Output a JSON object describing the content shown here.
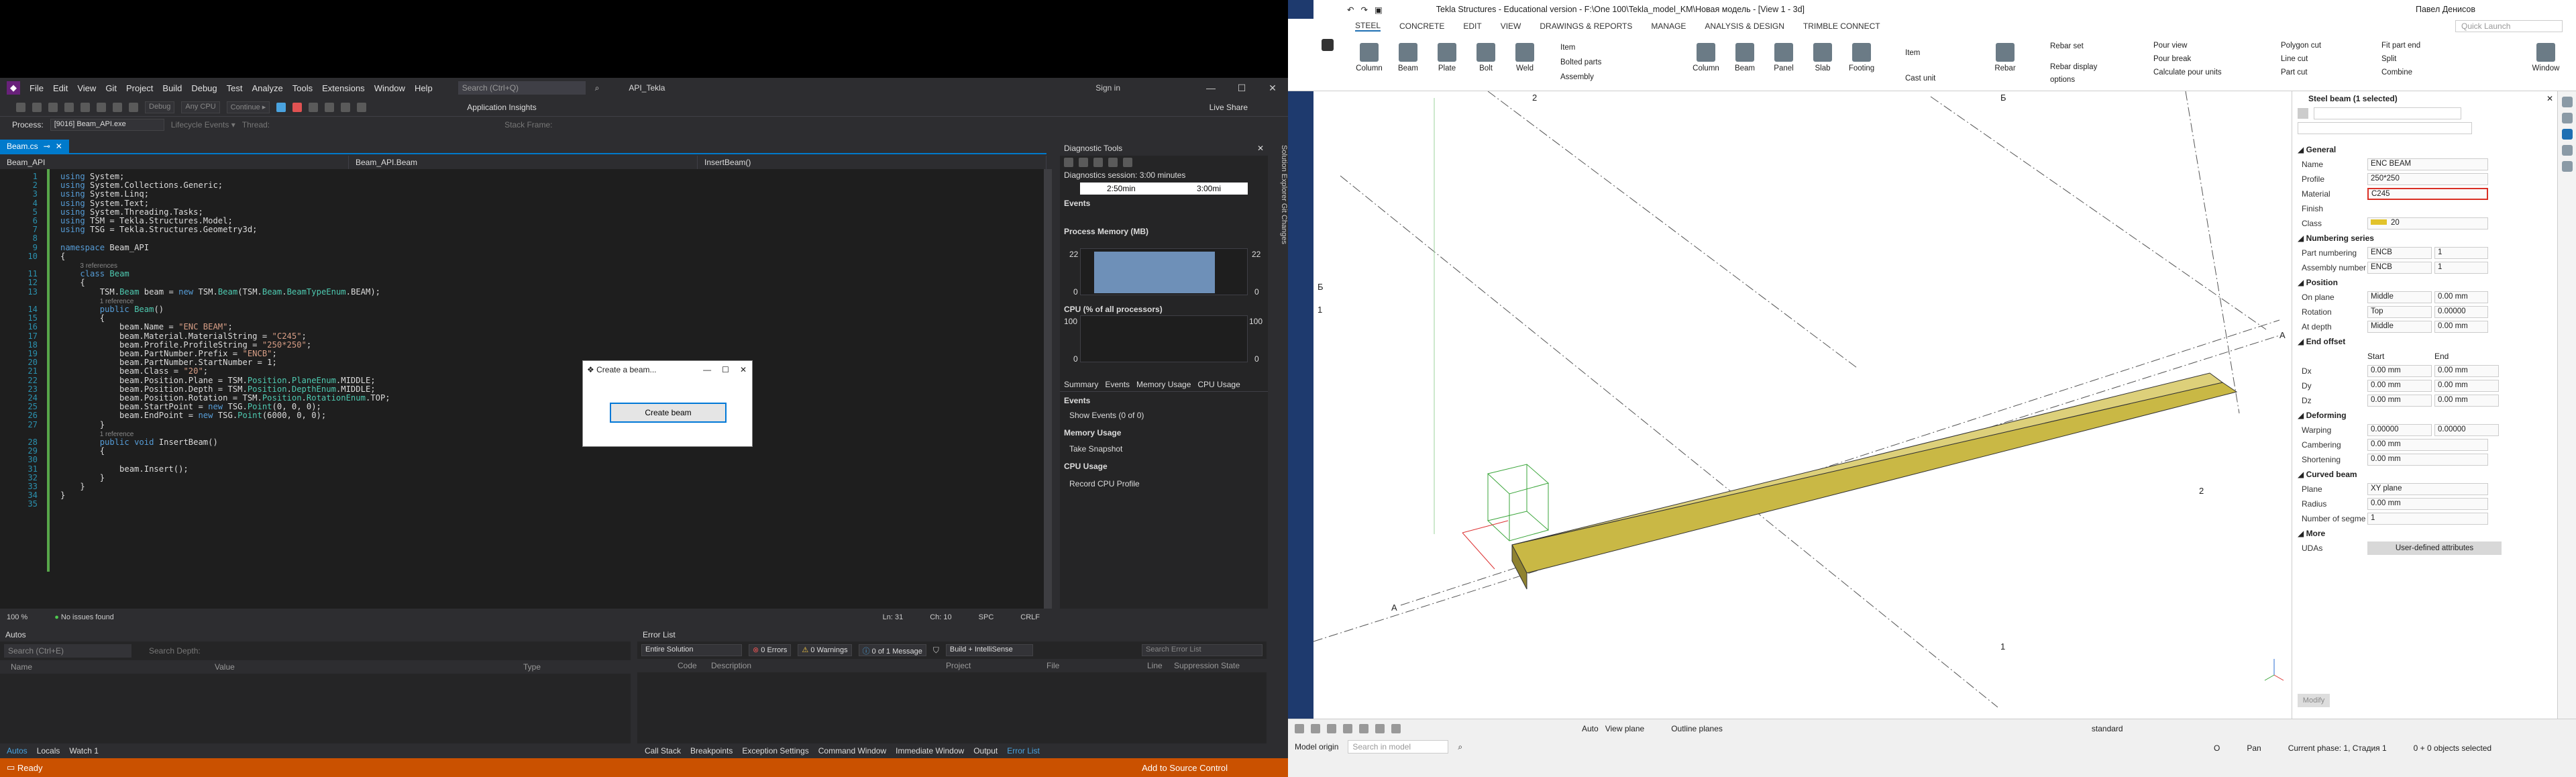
{
  "vs": {
    "menu": [
      "File",
      "Edit",
      "View",
      "Git",
      "Project",
      "Build",
      "Debug",
      "Test",
      "Analyze",
      "Tools",
      "Extensions",
      "Window",
      "Help"
    ],
    "search_placeholder": "Search (Ctrl+Q)",
    "solution_name": "API_Tekla",
    "sign_in": "Sign in",
    "toolbar": {
      "config": "Debug",
      "platform": "Any CPU",
      "continue": "Continue ▸",
      "app_insights": "Application Insights",
      "live_share": "Live Share"
    },
    "process": {
      "label": "Process:",
      "value": "[9016] Beam_API.exe",
      "lifecycle": "Lifecycle Events ▾",
      "thread": "Thread:",
      "stack_frame": "Stack Frame:"
    },
    "doc_tab": "Beam.cs",
    "navbar": {
      "project": "Beam_API",
      "class": "Beam_API.Beam",
      "member": "InsertBeam()"
    },
    "code_lines": [
      {
        "n": "1",
        "html": "<span class='kw'>using</span> System;"
      },
      {
        "n": "2",
        "html": "<span class='kw'>using</span> System.Collections.Generic;"
      },
      {
        "n": "3",
        "html": "<span class='kw'>using</span> System.Linq;"
      },
      {
        "n": "4",
        "html": "<span class='kw'>using</span> System.Text;"
      },
      {
        "n": "5",
        "html": "<span class='kw'>using</span> System.Threading.Tasks;"
      },
      {
        "n": "6",
        "html": "<span class='kw'>using</span> TSM = Tekla.Structures.Model;"
      },
      {
        "n": "7",
        "html": "<span class='kw'>using</span> TSG = Tekla.Structures.Geometry3d;"
      },
      {
        "n": "8",
        "html": ""
      },
      {
        "n": "9",
        "html": "<span class='kw'>namespace</span> Beam_API"
      },
      {
        "n": "10",
        "html": "{"
      },
      {
        "n": "",
        "html": "    <span class='cm'>3 references</span>"
      },
      {
        "n": "11",
        "html": "    <span class='kw'>class</span> <span class='ty'>Beam</span>"
      },
      {
        "n": "12",
        "html": "    {"
      },
      {
        "n": "13",
        "html": "        TSM.<span class='ty'>Beam</span> beam = <span class='kw'>new</span> TSM.<span class='ty'>Beam</span>(TSM.<span class='ty'>Beam</span>.<span class='ty'>BeamTypeEnum</span>.BEAM);"
      },
      {
        "n": "",
        "html": "        <span class='cm'>1 reference</span>"
      },
      {
        "n": "14",
        "html": "        <span class='kw'>public</span> <span class='ty'>Beam</span>()"
      },
      {
        "n": "15",
        "html": "        {"
      },
      {
        "n": "16",
        "html": "            beam.Name = <span class='st'>\"ENC BEAM\"</span>;"
      },
      {
        "n": "17",
        "html": "            beam.Material.MaterialString = <span class='st'>\"C245\"</span>;"
      },
      {
        "n": "18",
        "html": "            beam.Profile.ProfileString = <span class='st'>\"250*250\"</span>;"
      },
      {
        "n": "19",
        "html": "            beam.PartNumber.Prefix = <span class='st'>\"ENCB\"</span>;"
      },
      {
        "n": "20",
        "html": "            beam.PartNumber.StartNumber = 1;"
      },
      {
        "n": "21",
        "html": "            beam.Class = <span class='st'>\"20\"</span>;"
      },
      {
        "n": "22",
        "html": "            beam.Position.Plane = TSM.<span class='ty'>Position</span>.<span class='ty'>PlaneEnum</span>.MIDDLE;"
      },
      {
        "n": "23",
        "html": "            beam.Position.Depth = TSM.<span class='ty'>Position</span>.<span class='ty'>DepthEnum</span>.MIDDLE;"
      },
      {
        "n": "24",
        "html": "            beam.Position.Rotation = TSM.<span class='ty'>Position</span>.<span class='ty'>RotationEnum</span>.TOP;"
      },
      {
        "n": "25",
        "html": "            beam.StartPoint = <span class='kw'>new</span> TSG.<span class='ty'>Point</span>(0, 0, 0);"
      },
      {
        "n": "26",
        "html": "            beam.EndPoint = <span class='kw'>new</span> TSG.<span class='ty'>Point</span>(6000, 0, 0);"
      },
      {
        "n": "27",
        "html": "        }"
      },
      {
        "n": "",
        "html": "        <span class='cm'>1 reference</span>"
      },
      {
        "n": "28",
        "html": "        <span class='kw'>public</span> <span class='kw'>void</span> InsertBeam()"
      },
      {
        "n": "29",
        "html": "        {"
      },
      {
        "n": "30",
        "html": ""
      },
      {
        "n": "31",
        "html": "            beam.Insert();"
      },
      {
        "n": "32",
        "html": "        }"
      },
      {
        "n": "33",
        "html": "    }"
      },
      {
        "n": "34",
        "html": "}"
      },
      {
        "n": "35",
        "html": ""
      }
    ],
    "editor_status": {
      "zoom": "100 %",
      "issues": "No issues found",
      "ln": "Ln: 31",
      "ch": "Ch: 10",
      "spc": "SPC",
      "crlf": "CRLF"
    },
    "diagnostics": {
      "title": "Diagnostic Tools",
      "session": "Diagnostics session: 3:00 minutes",
      "t1": "2:50min",
      "t2": "3:00mi",
      "events": "Events",
      "memory": "Process Memory (MB)",
      "mem_max": "22",
      "mem_min": "0",
      "cpu": "CPU (% of all processors)",
      "cpu_max": "100",
      "cpu_min": "0",
      "tabs": [
        "Summary",
        "Events",
        "Memory Usage",
        "CPU Usage"
      ],
      "events_h": "Events",
      "show_events": "Show Events (0 of 0)",
      "memusage_h": "Memory Usage",
      "take_snapshot": "Take Snapshot",
      "cpuusage_h": "CPU Usage",
      "record_cpu": "Record CPU Profile"
    },
    "sidebar_tabs": "Solution Explorer   Git Changes",
    "autos": {
      "title": "Autos",
      "search": "Search (Ctrl+E)",
      "depth": "Search Depth:",
      "cols": [
        "Name",
        "Value",
        "Type"
      ]
    },
    "errors": {
      "title": "Error List",
      "scope": "Entire Solution",
      "errors": "0 Errors",
      "warnings": "0 Warnings",
      "messages": "0 of 1 Message",
      "build": "Build + IntelliSense",
      "search": "Search Error List",
      "cols": [
        "Code",
        "Description",
        "Project",
        "File",
        "Line",
        "Suppression State"
      ]
    },
    "bottom_left_tabs": [
      "Autos",
      "Locals",
      "Watch 1"
    ],
    "bottom_right_tabs": [
      "Call Stack",
      "Breakpoints",
      "Exception Settings",
      "Command Window",
      "Immediate Window",
      "Output",
      "Error List"
    ],
    "status": {
      "ready": "Ready",
      "source_control": "Add to Source Control"
    },
    "dialog": {
      "title": "Create a beam...",
      "button": "Create beam"
    }
  },
  "tekla": {
    "title": "Tekla Structures - Educational version - F:\\One 100\\Tekla_model_KM\\Новая модель - [View 1 - 3d]",
    "user": "Павел Денисов",
    "quick_launch": "Quick Launch",
    "tabs": [
      "STEEL",
      "CONCRETE",
      "EDIT",
      "VIEW",
      "DRAWINGS & REPORTS",
      "MANAGE",
      "ANALYSIS & DESIGN",
      "TRIMBLE CONNECT"
    ],
    "ribbon_left": [
      "Column",
      "Beam",
      "Plate",
      "Bolt",
      "Weld"
    ],
    "ribbon_small1": [
      "Item",
      "Bolted parts",
      "Assembly"
    ],
    "ribbon_mid": [
      "Column",
      "Beam",
      "Panel",
      "Slab",
      "Footing"
    ],
    "ribbon_small2": [
      "Item",
      "Cast unit"
    ],
    "ribbon_rebar": [
      "Rebar",
      "Rebar set",
      "Rebar display options"
    ],
    "ribbon_pour": [
      "Pour view",
      "Pour break",
      "Calculate pour units"
    ],
    "ribbon_cut": [
      "Polygon cut",
      "Line cut",
      "Part cut"
    ],
    "ribbon_fit": [
      "Fit part end",
      "Split",
      "Combine"
    ],
    "ribbon_window": "Window",
    "grid": [
      "2",
      "Б",
      "1",
      "A",
      "A",
      "2",
      "Б",
      "1"
    ],
    "props": {
      "title": "Steel beam (1 selected)",
      "general": "General",
      "name_l": "Name",
      "name_v": "ENC BEAM",
      "profile_l": "Profile",
      "profile_v": "250*250",
      "material_l": "Material",
      "material_v": "C245",
      "finish_l": "Finish",
      "finish_v": "",
      "class_l": "Class",
      "class_v": "20",
      "numbering": "Numbering series",
      "partnum_l": "Part numbering",
      "partnum_p": "ENCB",
      "partnum_n": "1",
      "asmnum_l": "Assembly number",
      "asmnum_p": "ENCB",
      "asmnum_n": "1",
      "position": "Position",
      "onplane_l": "On plane",
      "onplane_v": "Middle",
      "onplane_n": "0.00 mm",
      "rotation_l": "Rotation",
      "rotation_v": "Top",
      "rotation_n": "0.00000",
      "atdepth_l": "At depth",
      "atdepth_v": "Middle",
      "atdepth_n": "0.00 mm",
      "endoffset": "End offset",
      "start": "Start",
      "end": "End",
      "dx_l": "Dx",
      "dx_s": "0.00 mm",
      "dx_e": "0.00 mm",
      "dy_l": "Dy",
      "dy_s": "0.00 mm",
      "dy_e": "0.00 mm",
      "dz_l": "Dz",
      "dz_s": "0.00 mm",
      "dz_e": "0.00 mm",
      "deforming": "Deforming",
      "warping_l": "Warping",
      "warping_s": "0.00000",
      "warping_e": "0.00000",
      "cambering_l": "Cambering",
      "cambering_v": "0.00 mm",
      "shortening_l": "Shortening",
      "shortening_v": "0.00 mm",
      "curved": "Curved beam",
      "plane_l": "Plane",
      "plane_v": "XY plane",
      "radius_l": "Radius",
      "radius_v": "0.00 mm",
      "segments_l": "Number of segme",
      "segments_v": "1",
      "more": "More",
      "udas_l": "UDAs",
      "udas_btn": "User-defined attributes",
      "modify": "Modify"
    },
    "bottom": {
      "auto": "Auto",
      "view_plane": "View plane",
      "outline_planes": "Outline planes",
      "standard": "standard",
      "model_origin": "Model origin",
      "search": "Search in model"
    },
    "status": {
      "o": "O",
      "pan": "Pan",
      "phase": "Current phase: 1, Стадия 1",
      "selected": "0 + 0 objects selected"
    }
  }
}
